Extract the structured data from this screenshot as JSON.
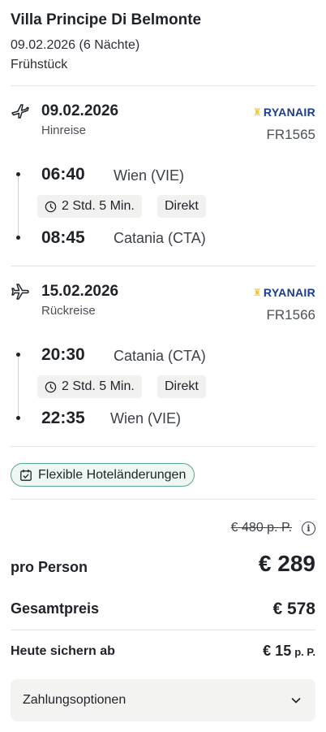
{
  "hotel": {
    "name": "Villa Principe Di Belmonte",
    "dates": "09.02.2026 (6 Nächte)",
    "board": "Frühstück"
  },
  "outbound": {
    "date": "09.02.2026",
    "direction": "Hinreise",
    "airline": "RYANAIR",
    "flight_number": "FR1565",
    "departure_time": "06:40",
    "departure_airport": "Wien (VIE)",
    "duration": "2 Std. 5 Min.",
    "stops": "Direkt",
    "arrival_time": "08:45",
    "arrival_airport": "Catania (CTA)"
  },
  "return": {
    "date": "15.02.2026",
    "direction": "Rückreise",
    "airline": "RYANAIR",
    "flight_number": "FR1566",
    "departure_time": "20:30",
    "departure_airport": "Catania (CTA)",
    "duration": "2 Std. 5 Min.",
    "stops": "Direkt",
    "arrival_time": "22:35",
    "arrival_airport": "Wien (VIE)"
  },
  "flex_badge": "Flexible Hoteländerungen",
  "pricing": {
    "old_price": "€ 480 p. P.",
    "per_person_label": "pro Person",
    "per_person_value": "€ 289",
    "total_label": "Gesamtpreis",
    "total_value": "€ 578",
    "deposit_label": "Heute sichern ab",
    "deposit_value": "€ 15",
    "deposit_unit": "p. P."
  },
  "payment_options_label": "Zahlungsoptionen",
  "icons": {
    "departure": "plane-departure-icon",
    "arrival": "plane-arrival-icon",
    "clock": "clock-icon",
    "calendar_check": "calendar-check-icon",
    "info": "info-icon",
    "chevron": "chevron-down-icon"
  },
  "colors": {
    "brand_ryanair": "#1b3b8e",
    "flex_border": "#5aa78b",
    "flex_bg": "#eef7f2"
  }
}
